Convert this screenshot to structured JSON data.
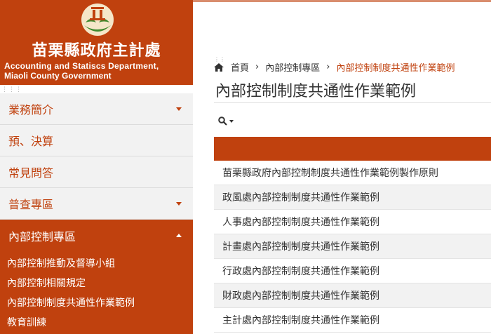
{
  "brand": {
    "name_zh": "苗栗縣政府主計處",
    "name_en_line1": "Accounting and Statiscs Department,",
    "name_en_line2": "Miaoli County Government"
  },
  "sidebar": {
    "items": [
      {
        "label": "業務簡介",
        "caret": "down"
      },
      {
        "label": "預、決算"
      },
      {
        "label": "常見問答"
      },
      {
        "label": "普查專區",
        "caret": "down"
      },
      {
        "label": "內部控制專區",
        "caret": "up",
        "active": true
      }
    ],
    "submenu": [
      "內部控制推動及督導小組",
      "內部控制相關規定",
      "內部控制制度共通性作業範例",
      "教育訓練"
    ]
  },
  "breadcrumb": {
    "home": "首頁",
    "sep": "›",
    "level1": "內部控制專區",
    "current": "內部控制制度共通性作業範例"
  },
  "page": {
    "title": "內部控制制度共通性作業範例"
  },
  "table": {
    "rows": [
      "苗栗縣政府內部控制制度共通性作業範例製作原則",
      "政風處內部控制制度共通性作業範例",
      "人事處內部控制制度共通性作業範例",
      "計畫處內部控制制度共通性作業範例",
      "行政處內部控制制度共通性作業範例",
      "財政處內部控制制度共通性作業範例",
      "主計處內部控制制度共通性作業範例"
    ]
  },
  "colors": {
    "accent": "#c0410e",
    "row_alt": "#f2f2f2"
  },
  "icons": [
    "logo-emblem",
    "home-icon",
    "search-icon",
    "chevron-down-icon",
    "chevron-up-icon"
  ]
}
